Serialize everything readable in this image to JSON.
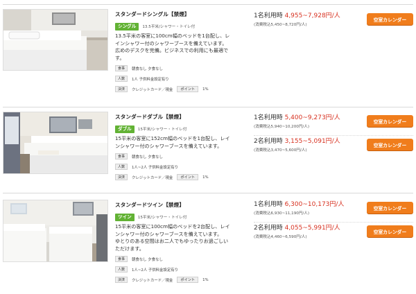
{
  "labels": {
    "meal": "食事",
    "people": "人数",
    "payment": "決済",
    "point": "ポイント"
  },
  "rooms": [
    {
      "title": "スタンダードシングル【禁煙】",
      "type_badge": "シングル",
      "type_detail": "13.5平米/シャワー・トイレ付",
      "desc": [
        "13.5平米の客室に100cm幅のベッドを1台配し、レ",
        "インシャワー付のシャワーブースを備えています。",
        "広めのデスクを完備。ビジネスでの利用にも最適で",
        "す。"
      ],
      "meal": "朝食なし 夕食なし",
      "people": "1人  子供料金設定有り",
      "payment": "クレジットカード／現金",
      "point": "1%",
      "plans": [
        {
          "label": "1名利用時 ",
          "price": "4,955~7,928円/人",
          "sub": "(消費税込5,450~8,720円/人)",
          "button": "空室カレンダー"
        }
      ]
    },
    {
      "title": "スタンダードダブル【禁煙】",
      "type_badge": "ダブル",
      "type_detail": "15平米/シャワー・トイレ付",
      "desc": [
        "15平米の客室に152cm幅のベッドを1台配し、レイ",
        "ンシャワー付のシャワーブースを備えています。"
      ],
      "meal": "朝食なし 夕食なし",
      "people": "1人~2人  子供料金設定有り",
      "payment": "クレジットカード／現金",
      "point": "1%",
      "plans": [
        {
          "label": "1名利用時 ",
          "price": "5,400~9,273円/人",
          "sub": "(消費税込5,940~10,200円/人)",
          "button": "空室カレンダー"
        },
        {
          "label": "2名利用時 ",
          "price": "3,155~5,091円/人",
          "sub": "(消費税込3,470~5,600円/人)",
          "button": "空室カレンダー"
        }
      ]
    },
    {
      "title": "スタンダードツイン【禁煙】",
      "type_badge": "ツイン",
      "type_detail": "15平米/シャワー・トイレ付",
      "desc": [
        "15平米の客室に100cm幅のベッドを2台配し、レイ",
        "ンシャワー付のシャワーブースを備えています。",
        "ゆとりのある空間はお二人でもゆったりお過ごしい",
        "ただけます。"
      ],
      "meal": "朝食なし 夕食なし",
      "people": "1人~2人  子供料金設定有り",
      "payment": "クレジットカード／現金",
      "point": "1%",
      "plans": [
        {
          "label": "1名利用時 ",
          "price": "6,300~10,173円/人",
          "sub": "(消費税込6,930~11,190円/人)",
          "button": "空室カレンダー"
        },
        {
          "label": "2名利用時 ",
          "price": "4,055~5,991円/人",
          "sub": "(消費税込4,460~6,590円/人)",
          "button": "空室カレンダー"
        }
      ]
    }
  ]
}
